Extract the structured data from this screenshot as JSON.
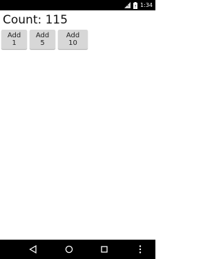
{
  "status_bar": {
    "time": "1:34",
    "icons": [
      "signal-icon",
      "battery-icon"
    ]
  },
  "main": {
    "count_text": "Count: 115",
    "buttons": [
      {
        "label": "Add 1"
      },
      {
        "label": "Add 5"
      },
      {
        "label": "Add 10"
      }
    ]
  },
  "nav_bar": {
    "icons": [
      "back-icon",
      "home-icon",
      "recents-icon",
      "overflow-menu-icon"
    ]
  },
  "colors": {
    "status_bar_bg": "#000000",
    "nav_bar_bg": "#000000",
    "button_bg": "#d7d7d7",
    "page_bg": "#ffffff"
  }
}
